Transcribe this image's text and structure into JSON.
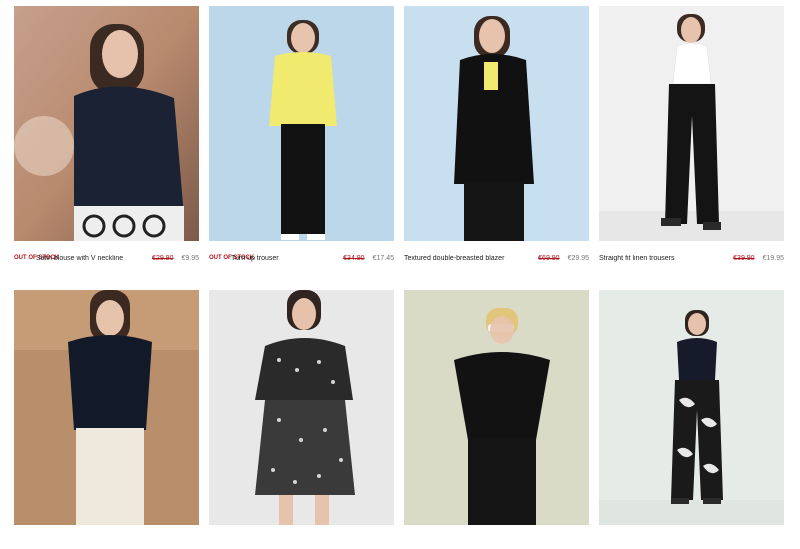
{
  "products": [
    {
      "title": "Satin blouse with V neckline",
      "badge": "OUT OF STOCK",
      "old_price": "€29.90",
      "price": "€9.95"
    },
    {
      "title": "Turn up trouser",
      "badge": "OUT OF STOCK",
      "old_price": "€34.90",
      "price": "€17.45"
    },
    {
      "title": "Textured double-breasted blazer",
      "badge": "",
      "old_price": "€69.90",
      "price": "€29.95"
    },
    {
      "title": "Straight fit linen trousers",
      "badge": "",
      "old_price": "€39.90",
      "price": "€19.95"
    },
    {
      "title": "",
      "badge": "",
      "old_price": "",
      "price": ""
    },
    {
      "title": "",
      "badge": "",
      "old_price": "",
      "price": ""
    },
    {
      "title": "",
      "badge": "",
      "old_price": "",
      "price": ""
    },
    {
      "title": "",
      "badge": "",
      "old_price": "",
      "price": ""
    }
  ],
  "colors": {
    "sale_red": "#b1121b",
    "muted_text": "#777777"
  }
}
